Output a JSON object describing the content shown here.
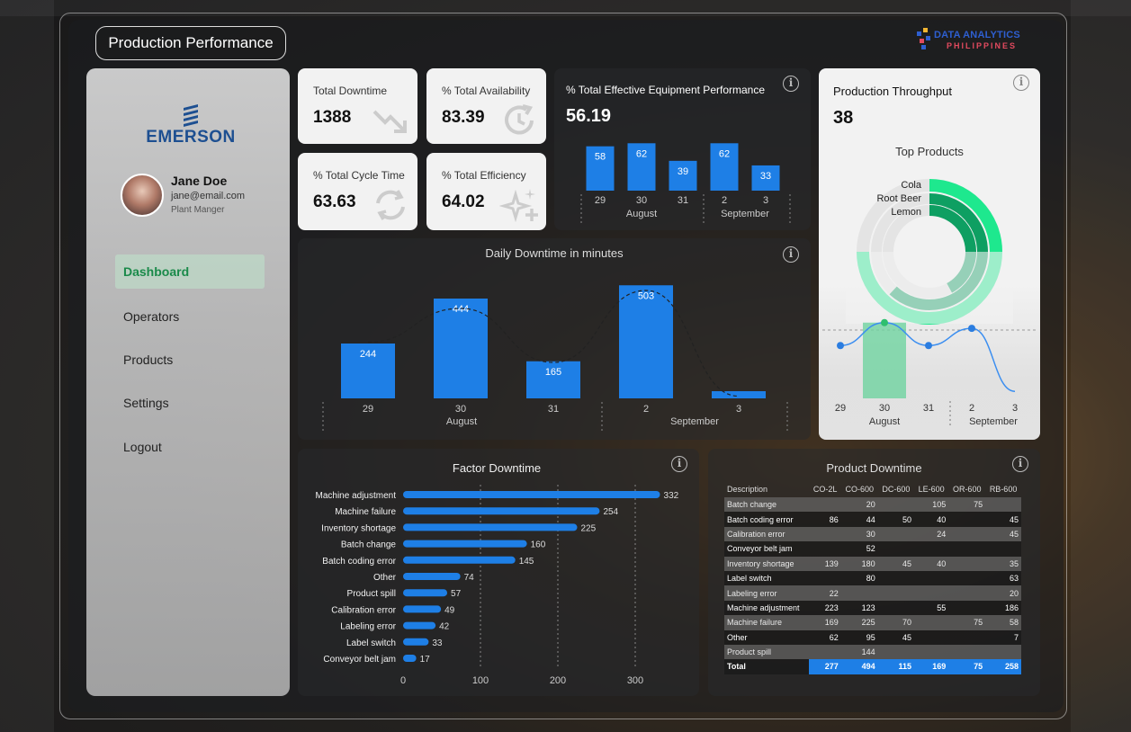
{
  "header": {
    "title": "Production Performance",
    "brand_line1": "DATA ANALYTICS",
    "brand_line2": "PHILIPPINES"
  },
  "sidebar": {
    "company": "EMERSON",
    "user": {
      "name": "Jane Doe",
      "email": "jane@email.com",
      "role": "Plant Manger"
    },
    "items": [
      {
        "label": "Dashboard",
        "active": true
      },
      {
        "label": "Operators"
      },
      {
        "label": "Products"
      },
      {
        "label": "Settings"
      },
      {
        "label": "Logout"
      }
    ]
  },
  "kpis": {
    "downtime": {
      "label": "Total Downtime",
      "value": "1388",
      "icon": "trend-down-icon"
    },
    "availability": {
      "label": "% Total Availability",
      "value": "83.39",
      "icon": "clock-refresh-icon"
    },
    "cycle": {
      "label": "% Total Cycle Time",
      "value": "63.63",
      "icon": "cycle-arrows-icon"
    },
    "efficiency": {
      "label": "% Total Efficiency",
      "value": "64.02",
      "icon": "sparkle-icon"
    }
  },
  "colors": {
    "bar": "#1e7fe6",
    "accent_green": "#1ee88e",
    "dark_green": "#0e9f62",
    "nav_active": "#1a8a4a"
  },
  "chart_data": [
    {
      "id": "oee",
      "type": "bar",
      "title": "% Total Effective Equipment Performance",
      "kpi": "56.19",
      "categories": [
        "29",
        "30",
        "31",
        "2",
        "3"
      ],
      "groups": [
        {
          "label": "August",
          "from": 0,
          "to": 2
        },
        {
          "label": "September",
          "from": 3,
          "to": 4
        }
      ],
      "values": [
        58,
        62,
        39,
        62,
        33
      ],
      "ylim": [
        0,
        80
      ]
    },
    {
      "id": "throughput",
      "type": "line",
      "title": "Production Throughput",
      "kpi": "38",
      "categories": [
        "29",
        "30",
        "31",
        "2",
        "3"
      ],
      "groups": [
        {
          "label": "August",
          "from": 0,
          "to": 2
        },
        {
          "label": "September",
          "from": 3,
          "to": 4
        }
      ],
      "values": [
        36,
        40,
        36,
        39,
        28
      ],
      "highlight": 1,
      "ylim": [
        26,
        42
      ],
      "donut": {
        "title": "Top Products",
        "labels": [
          "Cola",
          "Root Beer",
          "Lemon"
        ],
        "values": [
          0.75,
          0.62,
          0.42
        ]
      }
    },
    {
      "id": "daily",
      "type": "bar",
      "title": "Daily Downtime in minutes",
      "categories": [
        "29",
        "30",
        "31",
        "2",
        "3"
      ],
      "groups": [
        {
          "label": "August",
          "from": 0,
          "to": 2
        },
        {
          "label": "September",
          "from": 3,
          "to": 4
        }
      ],
      "values": [
        244,
        444,
        165,
        503,
        32
      ],
      "labels": [
        "244",
        "444",
        "165",
        "503",
        ""
      ],
      "trend": [
        250,
        400,
        160,
        480,
        10
      ],
      "ylim": [
        0,
        560
      ]
    },
    {
      "id": "factor",
      "type": "bar",
      "orientation": "horizontal",
      "title": "Factor Downtime",
      "categories": [
        "Machine adjustment",
        "Machine failure",
        "Inventory shortage",
        "Batch change",
        "Batch coding error",
        "Other",
        "Product spill",
        "Calibration error",
        "Labeling error",
        "Label switch",
        "Conveyor belt jam"
      ],
      "values": [
        332,
        254,
        225,
        160,
        145,
        74,
        57,
        49,
        42,
        33,
        17
      ],
      "xlim": [
        0,
        370
      ],
      "ticks": [
        0,
        100,
        200,
        300
      ]
    },
    {
      "id": "product_downtime",
      "type": "table",
      "title": "Product Downtime",
      "columns": [
        "Description",
        "CO-2L",
        "CO-600",
        "DC-600",
        "LE-600",
        "OR-600",
        "RB-600"
      ],
      "rows": [
        [
          "Batch change",
          "",
          "20",
          "",
          "105",
          "75",
          ""
        ],
        [
          "Batch coding error",
          "86",
          "44",
          "50",
          "40",
          "",
          "45"
        ],
        [
          "Calibration error",
          "",
          "30",
          "",
          "24",
          "",
          "45"
        ],
        [
          "Conveyor belt jam",
          "",
          "52",
          "",
          "",
          "",
          ""
        ],
        [
          "Inventory shortage",
          "139",
          "180",
          "45",
          "40",
          "",
          "35"
        ],
        [
          "Label switch",
          "",
          "80",
          "",
          "",
          "",
          "63"
        ],
        [
          "Labeling error",
          "22",
          "",
          "",
          "",
          "",
          "20"
        ],
        [
          "Machine adjustment",
          "223",
          "123",
          "",
          "55",
          "",
          "186"
        ],
        [
          "Machine failure",
          "169",
          "225",
          "70",
          "",
          "75",
          "58"
        ],
        [
          "Other",
          "62",
          "95",
          "45",
          "",
          "",
          "7"
        ],
        [
          "Product spill",
          "",
          "144",
          "",
          "",
          "",
          ""
        ]
      ],
      "total": [
        "Total",
        "277",
        "494",
        "115",
        "169",
        "75",
        "258"
      ]
    }
  ]
}
